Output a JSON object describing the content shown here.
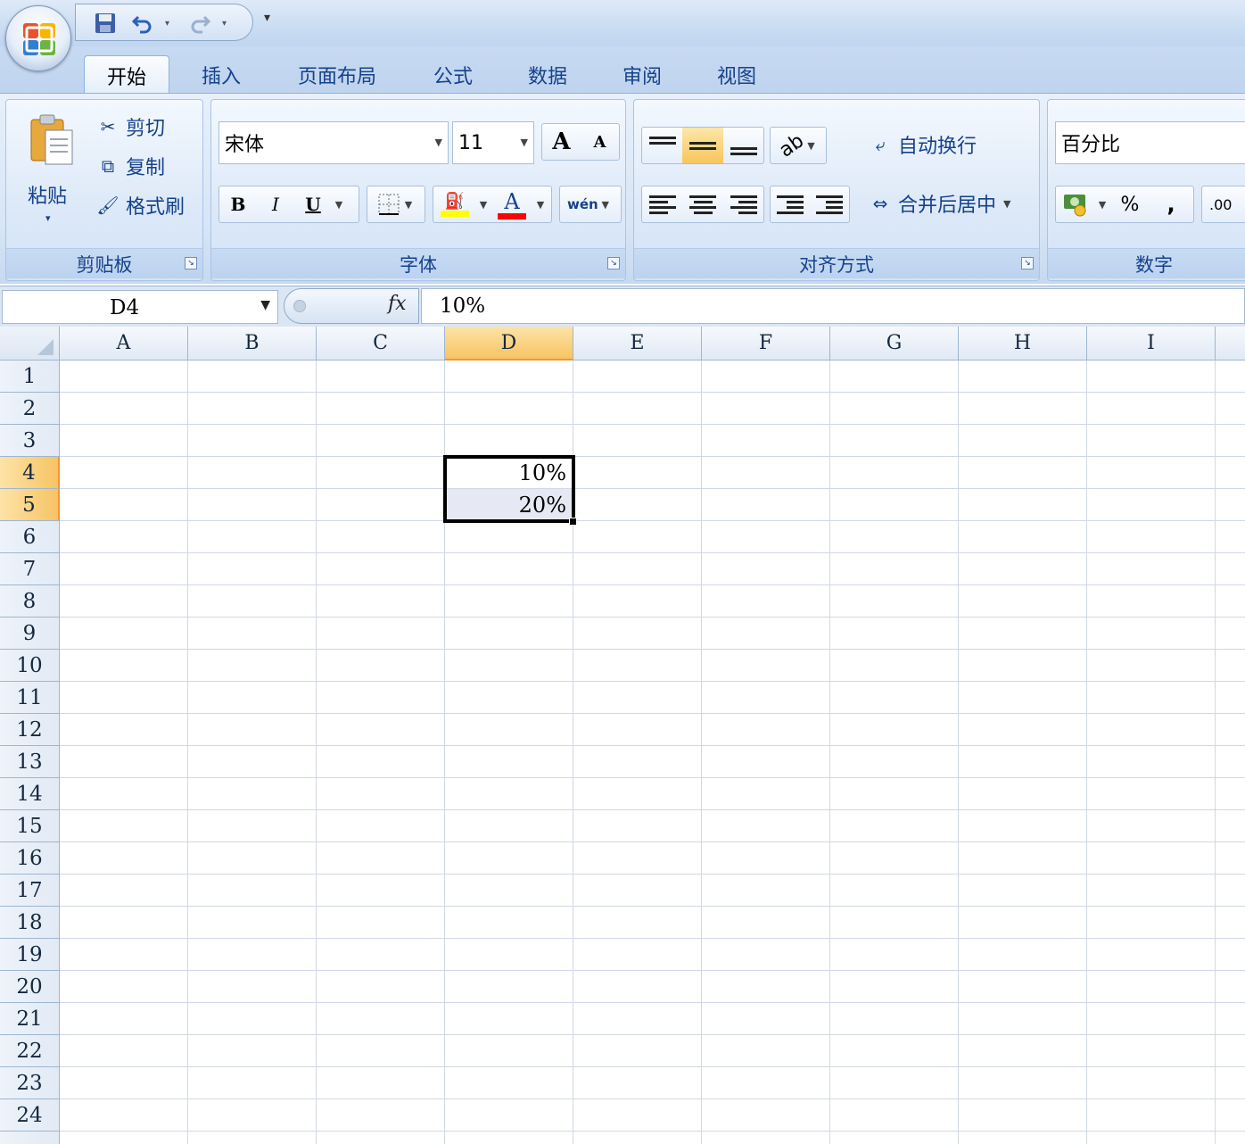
{
  "quick_access": {
    "icons": [
      "save-icon",
      "undo-icon",
      "redo-icon"
    ],
    "more": "▾"
  },
  "tabs": [
    {
      "label": "开始",
      "active": true
    },
    {
      "label": "插入"
    },
    {
      "label": "页面布局"
    },
    {
      "label": "公式"
    },
    {
      "label": "数据"
    },
    {
      "label": "审阅"
    },
    {
      "label": "视图"
    }
  ],
  "clipboard": {
    "paste_label": "粘贴",
    "cut_label": "剪切",
    "copy_label": "复制",
    "format_painter_label": "格式刷",
    "group_label": "剪贴板"
  },
  "font": {
    "font_name": "宋体",
    "font_size": "11",
    "grow_label": "A",
    "shrink_label": "A",
    "bold_label": "B",
    "italic_label": "I",
    "underline_label": "U",
    "font_color_label": "A",
    "phonetic_label": "wén",
    "group_label": "字体",
    "fill_color": "#ffff00",
    "font_color": "#ff0000"
  },
  "alignment": {
    "wrap_text_label": "自动换行",
    "merge_center_label": "合并后居中",
    "group_label": "对齐方式"
  },
  "number": {
    "format_value": "百分比",
    "percent_label": "%",
    "comma_label": ",",
    "increase_decimal_label": ".00",
    "group_label": "数字"
  },
  "formula_bar": {
    "name_box": "D4",
    "fx_label": "fx",
    "content": "10%"
  },
  "grid": {
    "columns": [
      "A",
      "B",
      "C",
      "D",
      "E",
      "F",
      "G",
      "H",
      "I"
    ],
    "selected_column": "D",
    "rows": [
      "1",
      "2",
      "3",
      "4",
      "5",
      "6",
      "7",
      "8",
      "9",
      "10",
      "11",
      "12",
      "13",
      "14",
      "15",
      "16",
      "17",
      "18",
      "19",
      "20",
      "21",
      "22",
      "23",
      "24"
    ],
    "selected_rows": [
      "4",
      "5"
    ],
    "cells": [
      {
        "ref": "D4",
        "value": "10%"
      },
      {
        "ref": "D5",
        "value": "20%"
      }
    ]
  }
}
